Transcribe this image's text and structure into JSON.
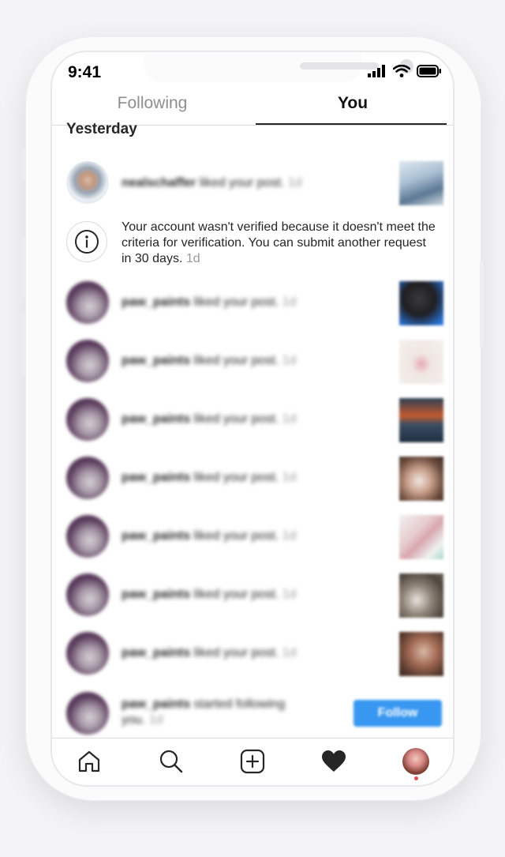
{
  "status_bar": {
    "time": "9:41"
  },
  "tabs": {
    "following": "Following",
    "you": "You"
  },
  "section_title": "Yesterday",
  "activity": [
    {
      "user": "nealschaffer",
      "action": "liked your post.",
      "time": "1d"
    },
    {
      "notice": "Your account wasn't verified because it doesn't meet the criteria for verification. You can submit another request in 30 days.",
      "time": "1d"
    },
    {
      "user": "paw_paints",
      "action": "liked your post.",
      "time": "1d"
    },
    {
      "user": "paw_paints",
      "action": "liked your post.",
      "time": "1d"
    },
    {
      "user": "paw_paints",
      "action": "liked your post.",
      "time": "1d"
    },
    {
      "user": "paw_paints",
      "action": "liked your post.",
      "time": "1d"
    },
    {
      "user": "paw_paints",
      "action": "liked your post.",
      "time": "1d"
    },
    {
      "user": "paw_paints",
      "action": "liked your post.",
      "time": "1d"
    },
    {
      "user": "paw_paints",
      "action": "liked your post.",
      "time": "1d"
    },
    {
      "user": "paw_paints",
      "action": "started following",
      "action2": "you.",
      "time": "1d"
    }
  ],
  "follow_button": "Follow",
  "bottom_nav": [
    "home-icon",
    "search-icon",
    "add-post-icon",
    "activity-heart-icon",
    "profile-avatar"
  ],
  "colors": {
    "accent": "#3897f0",
    "notification_dot": "#ed4956"
  }
}
